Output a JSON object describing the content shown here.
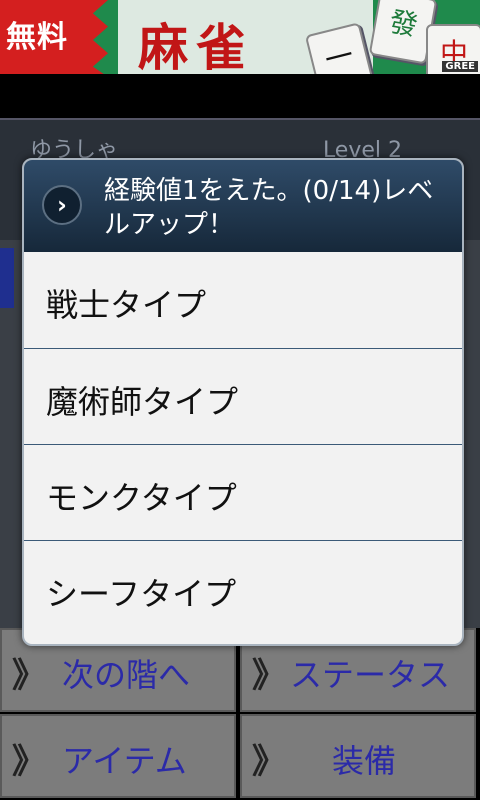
{
  "banner": {
    "free_label": "無料",
    "title": "麻雀",
    "gree_label": "GREE"
  },
  "character": {
    "name": "ゆうしゃ",
    "level": "Level 2"
  },
  "dialog": {
    "title": "経験値1をえた。(0/14)レベルアップ！",
    "options": [
      "戦士タイプ",
      "魔術師タイプ",
      "モンクタイプ",
      "シーフタイプ"
    ]
  },
  "buttons": [
    {
      "icon": "》",
      "label": "次の階へ"
    },
    {
      "icon": "》",
      "label": "ステータス"
    },
    {
      "icon": "》",
      "label": "アイテム"
    },
    {
      "icon": "》",
      "label": "装備"
    }
  ],
  "colors": {
    "dialog_header": "#1f3650",
    "option_text": "#111111",
    "button_text": "#2b2aa8",
    "free_badge": "#d41f1f"
  }
}
